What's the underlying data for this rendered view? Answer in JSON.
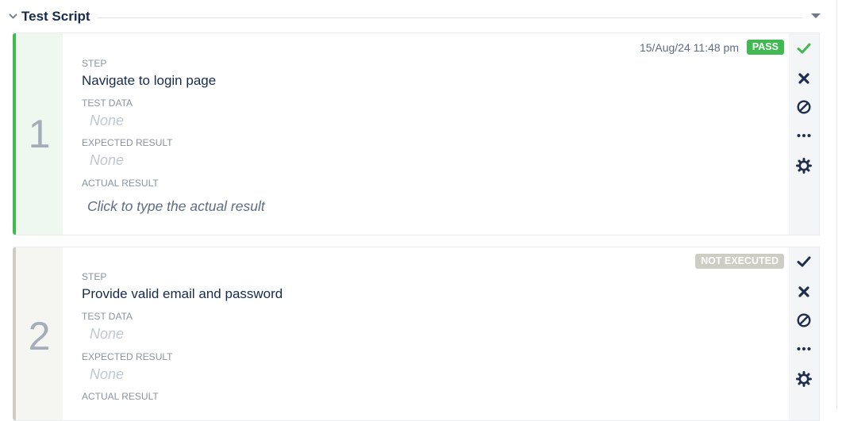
{
  "section": {
    "title": "Test Script"
  },
  "steps": [
    {
      "number": "1",
      "status": "PASS",
      "timestamp": "15/Aug/24 11:48 pm",
      "labels": {
        "step": "STEP",
        "test_data": "TEST DATA",
        "expected": "EXPECTED RESULT",
        "actual": "ACTUAL RESULT"
      },
      "step_text": "Navigate to login page",
      "test_data": "None",
      "expected_result": "None",
      "actual_placeholder": "Click to type the actual result",
      "accent_color": "#3fb950"
    },
    {
      "number": "2",
      "status": "NOT EXECUTED",
      "labels": {
        "step": "STEP",
        "test_data": "TEST DATA",
        "expected": "EXPECTED RESULT",
        "actual": "ACTUAL RESULT"
      },
      "step_text": "Provide valid email and password",
      "test_data": "None",
      "expected_result": "None",
      "accent_color": "#cdcdc4"
    }
  ],
  "actions": [
    "pass-check-icon",
    "fail-x-icon",
    "block-icon",
    "more-ellipsis-icon",
    "settings-gear-icon"
  ],
  "colors": {
    "pass_check": "#3fb950",
    "icon_dark": "#1f2e4d",
    "border": "#ebecf0"
  }
}
